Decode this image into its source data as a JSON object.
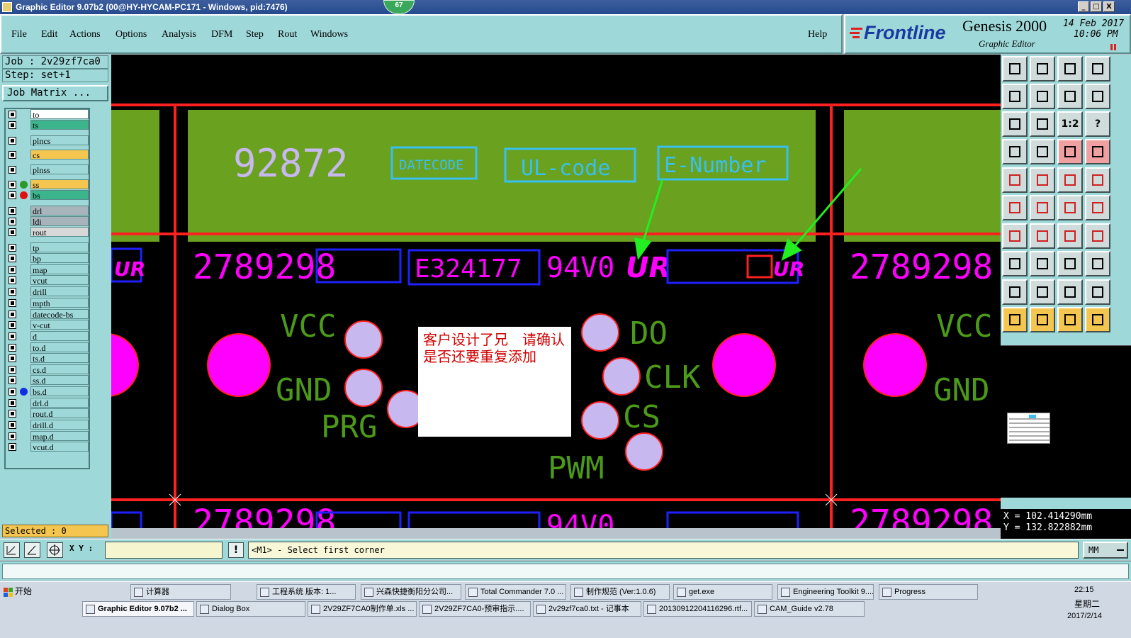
{
  "window": {
    "title": "Graphic Editor 9.07b2 (00@HY-HYCAM-PC171 - Windows, pid:7476)",
    "pid_badge": "67",
    "controls": [
      "_",
      "□",
      "X"
    ]
  },
  "menu": {
    "items": [
      "File",
      "Edit",
      "Actions",
      "Options",
      "Analysis",
      "DFM",
      "Step",
      "Rout",
      "Windows"
    ],
    "help": "Help"
  },
  "brand": {
    "logo": "Frontline",
    "product": "Genesis 2000",
    "subtitle": "Graphic Editor",
    "date": "14 Feb 2017",
    "time": "10:06 PM"
  },
  "job": {
    "job_line": "Job : 2v29zf7ca0",
    "step_line": "Step: set+1",
    "matrix_button": "Job Matrix ..."
  },
  "layers": [
    {
      "name": "to",
      "bg": "#ffffff"
    },
    {
      "name": "ts",
      "bg": "#3cb48c"
    },
    {
      "name": "plncs",
      "bg": "#9fd8d8"
    },
    {
      "name": "cs",
      "bg": "#f5c64f"
    },
    {
      "name": "plnss",
      "bg": "#9fd8d8"
    },
    {
      "name": "ss",
      "bg": "#f5c64f",
      "dot": "#2a9a2a"
    },
    {
      "name": "bs",
      "bg": "#3cb48c",
      "dot": "#e01010"
    },
    {
      "name": "drl",
      "bg": "#a8b4bc"
    },
    {
      "name": "ldi",
      "bg": "#a8b4bc"
    },
    {
      "name": "rout",
      "bg": "#d8d8d8"
    },
    {
      "name": "tp",
      "bg": "#9fd8d8"
    },
    {
      "name": "bp",
      "bg": "#9fd8d8"
    },
    {
      "name": "map",
      "bg": "#9fd8d8"
    },
    {
      "name": "vcut",
      "bg": "#9fd8d8"
    },
    {
      "name": "drill",
      "bg": "#9fd8d8"
    },
    {
      "name": "mpth",
      "bg": "#9fd8d8"
    },
    {
      "name": "datecode-bs",
      "bg": "#9fd8d8"
    },
    {
      "name": "v-cut",
      "bg": "#9fd8d8"
    },
    {
      "name": "d",
      "bg": "#9fd8d8"
    },
    {
      "name": "to.d",
      "bg": "#9fd8d8"
    },
    {
      "name": "ts.d",
      "bg": "#9fd8d8"
    },
    {
      "name": "cs.d",
      "bg": "#9fd8d8"
    },
    {
      "name": "ss.d",
      "bg": "#9fd8d8"
    },
    {
      "name": "bs.d",
      "bg": "#9fd8d8",
      "dot": "#1030e0"
    },
    {
      "name": "drl.d",
      "bg": "#9fd8d8"
    },
    {
      "name": "rout.d",
      "bg": "#9fd8d8"
    },
    {
      "name": "drill.d",
      "bg": "#9fd8d8"
    },
    {
      "name": "map.d",
      "bg": "#9fd8d8"
    },
    {
      "name": "vcut.d",
      "bg": "#9fd8d8"
    }
  ],
  "selected": "Selected : 0",
  "board": {
    "top_number": "92872",
    "top_datecode": "DATECODE",
    "top_ulcode": "UL-code",
    "top_enumber": "E-Number",
    "row_text": "2789298",
    "row_code": "E324177",
    "row_9440": "94V0",
    "row_ul": "UR",
    "pin_vcc": "VCC",
    "pin_gnd": "GND",
    "pin_prg": "PRG",
    "pin_do": "DO",
    "pin_clk": "CLK",
    "pin_cs": "CS",
    "pin_pwm": "PWM",
    "colors": {
      "green_panel": "#6aa11e",
      "silk": "#ff00ff",
      "outline": "#ff2020",
      "pad": "#c8b8f0",
      "frame": "#2020ff",
      "text_green": "#4c9a1a",
      "arrow": "#22ee22"
    }
  },
  "note": {
    "text": "客户设计了兄　请确认是否还要重复添加"
  },
  "coords": {
    "x": "X = 102.414290mm",
    "y": "Y = 132.822882mm"
  },
  "command": {
    "xy_label": "X Y :",
    "xy_value": "",
    "prompt": "<M1> - Select first corner",
    "units": "MM"
  },
  "toolbar_labels": {
    "ratio": "1:2",
    "help": "?"
  },
  "taskbar": {
    "start": "开始",
    "row1": [
      "计算器",
      "工程系统  版本: 1...",
      "兴森快捷衡阳分公司...",
      "Total Commander 7.0 ...",
      "制作规范 (Ver:1.0.6)",
      "get.exe",
      "Engineering Toolkit 9....",
      "Progress"
    ],
    "row2": [
      "Graphic Editor 9.07b2 ...",
      "Dialog Box",
      "2V29ZF7CA0制作单.xls ...",
      "2V29ZF7CA0-预审指示....",
      "2v29zf7ca0.txt - 记事本",
      "20130912204116296.rtf...",
      "CAM_Guide v2.78"
    ],
    "clock_time": "22:15",
    "clock_day": "星期二",
    "clock_date": "2017/2/14"
  }
}
